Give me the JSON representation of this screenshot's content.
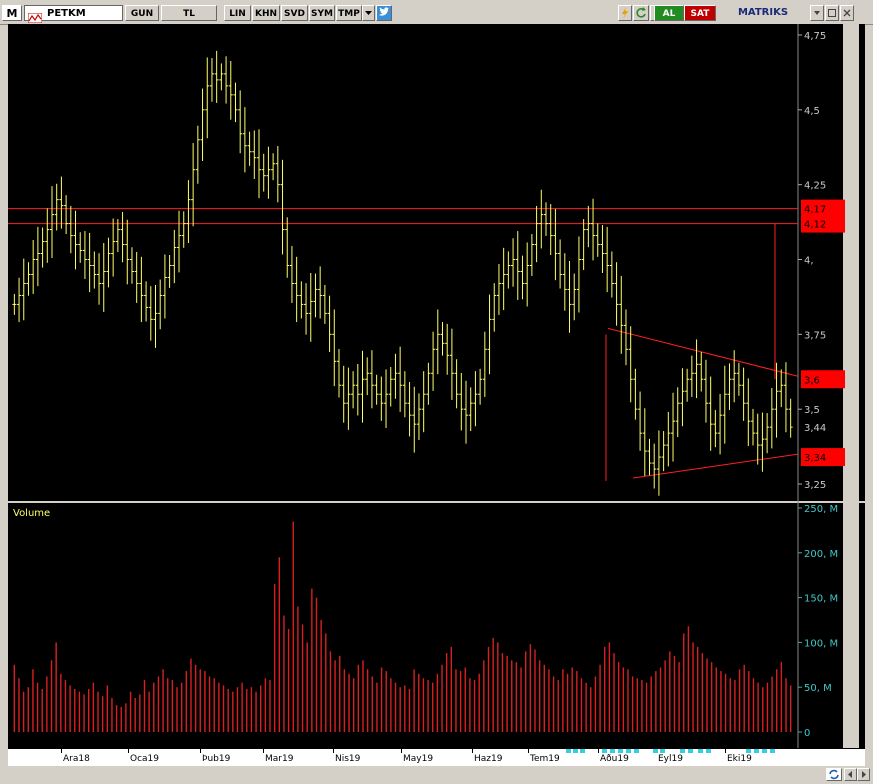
{
  "app": {
    "menu_logo": "M",
    "symbol": "PETKM",
    "toolbar": {
      "period": "GUN",
      "currency": "TL",
      "scale": "LIN",
      "khn": "KHN",
      "svd": "SVD",
      "sym": "SYM",
      "tmp": "TMP"
    },
    "buttons": {
      "c": "C",
      "buy": "AL",
      "sell": "SAT"
    },
    "brand": "MATRIKS",
    "colors": {
      "background": "#000000",
      "price_bars": "#ffff66",
      "volume_bars": "#d92020",
      "trend_lines": "#ff2020",
      "level_tag": "#ff0000",
      "axis_text": "#c8c8c8",
      "volume_axis_text": "#40c8c8",
      "volume_title": "#ffff66"
    },
    "icons": {
      "chart": "chart-icon",
      "dropdown": "chevron-down-icon",
      "twitter": "twitter-icon",
      "lightning": "lightning-icon",
      "refresh": "refresh-icon",
      "window_min": "minimize-icon",
      "window_max": "maximize-icon",
      "window_close": "close-icon",
      "sync": "sync-icon",
      "nav_left": "arrow-left-icon",
      "nav_right": "arrow-right-icon"
    }
  },
  "chart_data": {
    "price_chart": {
      "type": "ohlc",
      "symbol": "PETKM",
      "y_range": [
        3.2,
        4.78
      ],
      "y_ticks": [
        "4,75",
        "4,5",
        "4,25",
        "4,",
        "3,75",
        "3,5",
        "3,25"
      ],
      "y_tick_values": [
        4.75,
        4.5,
        4.25,
        4.0,
        3.75,
        3.5,
        3.25
      ],
      "x_labels": [
        "Ara18",
        "Oca19",
        "Þub19",
        "Mar19",
        "Nis19",
        "May19",
        "Haz19",
        "Tem19",
        "Aðu19",
        "Eyl19",
        "Eki19"
      ],
      "last_price": "3,44",
      "level_tags": [
        {
          "label": "4,17",
          "value": 4.17
        },
        {
          "label": "4,12",
          "value": 4.12
        },
        {
          "label": "3,6",
          "value": 3.6
        },
        {
          "label": "3,34",
          "value": 3.34
        }
      ],
      "horizontal_lines": [
        4.17,
        4.12
      ],
      "close": [
        3.85,
        3.88,
        3.92,
        3.95,
        4.0,
        4.02,
        4.06,
        4.1,
        4.15,
        4.2,
        4.18,
        4.12,
        4.08,
        4.05,
        4.03,
        4.0,
        3.98,
        3.95,
        3.92,
        3.96,
        4.02,
        4.06,
        4.1,
        4.05,
        4.0,
        3.96,
        3.92,
        3.88,
        3.84,
        3.8,
        3.82,
        3.88,
        3.94,
        3.98,
        4.04,
        4.08,
        4.12,
        4.2,
        4.3,
        4.4,
        4.5,
        4.58,
        4.62,
        4.6,
        4.62,
        4.58,
        4.55,
        4.5,
        4.42,
        4.38,
        4.36,
        4.34,
        4.3,
        4.28,
        4.3,
        4.32,
        4.25,
        4.1,
        3.98,
        3.92,
        3.88,
        3.85,
        3.82,
        3.86,
        3.9,
        3.88,
        3.82,
        3.75,
        3.66,
        3.58,
        3.52,
        3.55,
        3.58,
        3.55,
        3.6,
        3.62,
        3.58,
        3.55,
        3.52,
        3.55,
        3.6,
        3.62,
        3.58,
        3.52,
        3.48,
        3.45,
        3.5,
        3.55,
        3.62,
        3.7,
        3.75,
        3.72,
        3.68,
        3.62,
        3.55,
        3.5,
        3.48,
        3.52,
        3.55,
        3.6,
        3.7,
        3.8,
        3.88,
        3.92,
        3.95,
        3.98,
        4.0,
        3.96,
        3.92,
        3.98,
        4.05,
        4.12,
        4.15,
        4.12,
        4.08,
        4.02,
        3.95,
        3.9,
        3.85,
        3.9,
        4.0,
        4.1,
        4.12,
        4.08,
        4.05,
        4.02,
        3.98,
        3.92,
        3.85,
        3.78,
        3.7,
        3.6,
        3.5,
        3.42,
        3.36,
        3.32,
        3.3,
        3.34,
        3.38,
        3.42,
        3.46,
        3.52,
        3.56,
        3.6,
        3.62,
        3.65,
        3.6,
        3.52,
        3.45,
        3.42,
        3.48,
        3.55,
        3.6,
        3.62,
        3.58,
        3.52,
        3.46,
        3.42,
        3.38,
        3.4,
        3.44,
        3.5,
        3.56,
        3.58,
        3.5,
        3.44
      ]
    },
    "volume_chart": {
      "type": "bar",
      "title": "Volume",
      "y_range": [
        0,
        250
      ],
      "y_ticks": [
        "250, M",
        "200, M",
        "150, M",
        "100, M",
        "50, M",
        "0"
      ],
      "y_tick_values": [
        250,
        200,
        150,
        100,
        50,
        0
      ],
      "values": [
        75,
        60,
        45,
        50,
        70,
        55,
        48,
        62,
        80,
        100,
        65,
        58,
        52,
        48,
        45,
        42,
        48,
        55,
        45,
        40,
        52,
        38,
        30,
        28,
        32,
        45,
        38,
        42,
        58,
        45,
        55,
        62,
        70,
        60,
        58,
        50,
        55,
        68,
        82,
        75,
        70,
        68,
        62,
        60,
        55,
        52,
        48,
        45,
        50,
        55,
        48,
        50,
        45,
        52,
        60,
        58,
        165,
        195,
        130,
        115,
        235,
        140,
        120,
        100,
        160,
        150,
        125,
        110,
        90,
        80,
        85,
        70,
        65,
        60,
        75,
        80,
        70,
        62,
        55,
        72,
        68,
        60,
        55,
        50,
        52,
        48,
        70,
        65,
        60,
        58,
        55,
        65,
        75,
        88,
        95,
        70,
        68,
        72,
        60,
        58,
        65,
        80,
        95,
        105,
        100,
        88,
        85,
        80,
        78,
        72,
        90,
        98,
        92,
        80,
        75,
        70,
        62,
        58,
        70,
        65,
        72,
        68,
        60,
        55,
        50,
        62,
        75,
        95,
        100,
        88,
        78,
        72,
        70,
        62,
        60,
        58,
        55,
        62,
        68,
        72,
        80,
        90,
        85,
        78,
        110,
        118,
        100,
        95,
        88,
        82,
        78,
        72,
        68,
        65,
        60,
        58,
        70,
        75,
        68,
        60,
        55,
        50,
        55,
        62,
        70,
        78,
        60,
        52
      ]
    }
  }
}
